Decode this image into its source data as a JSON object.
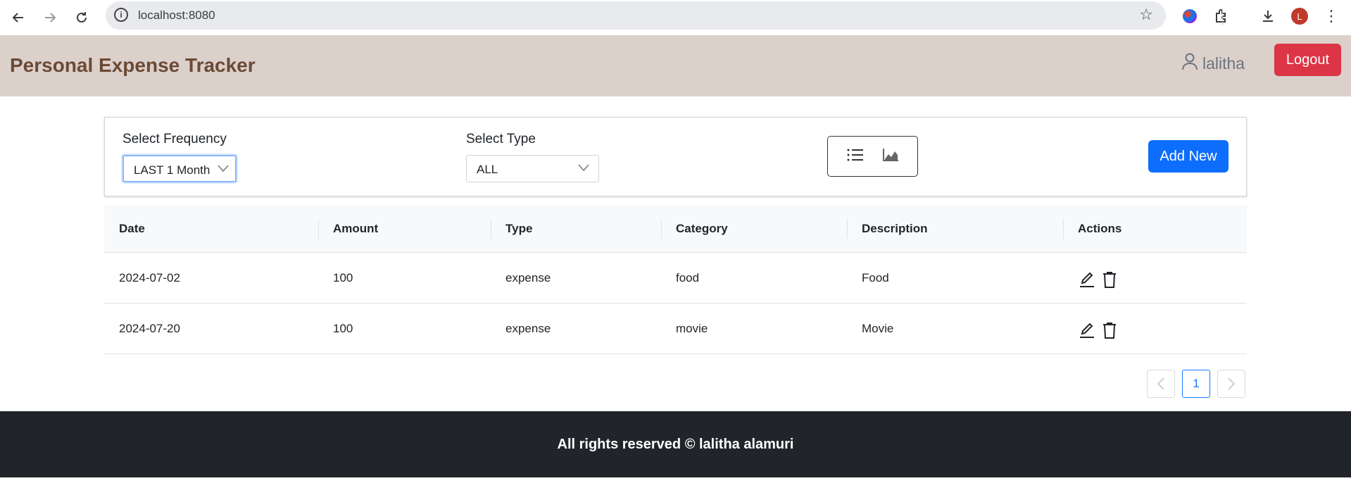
{
  "browser": {
    "url": "localhost:8080",
    "profile_initial": "L"
  },
  "header": {
    "brand": "Personal Expense Tracker",
    "username": "lalitha",
    "logout_label": "Logout"
  },
  "filters": {
    "frequency_label": "Select Frequency",
    "frequency_value": "LAST 1 Month",
    "type_label": "Select Type",
    "type_value": "ALL",
    "add_new_label": "Add New"
  },
  "table": {
    "headers": [
      "Date",
      "Amount",
      "Type",
      "Category",
      "Description",
      "Actions"
    ],
    "rows": [
      [
        "2024-07-02",
        "100",
        "expense",
        "food",
        "Food"
      ],
      [
        "2024-07-20",
        "100",
        "expense",
        "movie",
        "Movie"
      ]
    ]
  },
  "pagination": {
    "current_page": "1"
  },
  "footer": {
    "text": "All rights reserved © lalitha alamuri"
  },
  "colors": {
    "header_bg": "#dcd0cb",
    "brand_text": "#6b4a35",
    "logout": "#dc3545",
    "primary": "#0d6efd",
    "footer_bg": "#212529"
  }
}
